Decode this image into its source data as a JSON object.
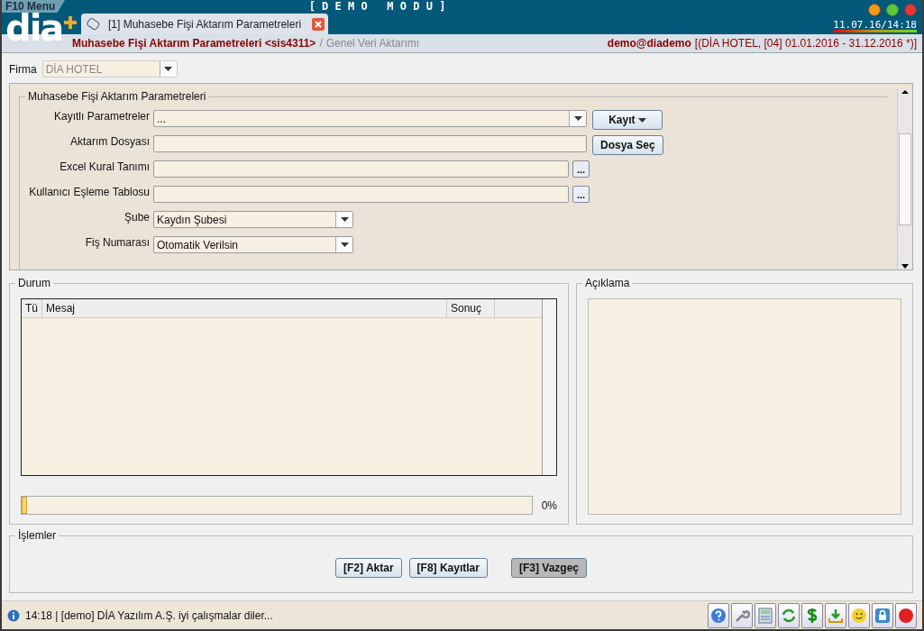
{
  "header": {
    "menu": "F10 Menu",
    "mode": "[ D E M O   M O D U ]",
    "logo": "dia",
    "clock": "11.07.16/14:18"
  },
  "tab": {
    "label": "[1] Muhasebe Fişi Aktarım Parametreleri",
    "selected": true
  },
  "breadcrumb": {
    "title": "Muhasebe Fişi Aktarım Parametreleri <sis4311>",
    "separator": "/",
    "parent": "Genel Veri Aktarımı"
  },
  "user": {
    "name": "demo@diademo",
    "context": "[(DİA HOTEL, [04] 01.01.2016 - 31.12.2016 *)]"
  },
  "firma": {
    "label": "Firma",
    "value": "DİA HOTEL",
    "disabled": true
  },
  "params": {
    "title": "Muhasebe Fişi Aktarım Parametreleri",
    "fields": [
      {
        "kind": "combo",
        "label": "Kayıtlı Parametreler",
        "value": "...",
        "button": "Kayıt"
      },
      {
        "kind": "file",
        "label": "Aktarım Dosyası",
        "button": "Dosya Seç"
      },
      {
        "kind": "lookup",
        "label": "Excel Kural Tanımı",
        "button": "..."
      },
      {
        "kind": "lookup",
        "label": "Kullanıcı Eşleme Tablosu",
        "button": "..."
      },
      {
        "kind": "select",
        "label": "Şube",
        "value": "Kaydın Şubesi"
      },
      {
        "kind": "select",
        "label": "Fiş Numarası",
        "value": "Otomatik Verilsin"
      }
    ]
  },
  "durum": {
    "title": "Durum",
    "columns": [
      "Tü",
      "Mesaj",
      "Sonuç"
    ],
    "progress": {
      "level": 0.01,
      "reading": "0%"
    }
  },
  "aciklama": {
    "title": "Açıklama"
  },
  "islemler": {
    "title": "İşlemler",
    "buttons": [
      {
        "label": "[F2] Aktar",
        "kind": "primary"
      },
      {
        "label": "[F8] Kayıtlar",
        "kind": "primary"
      },
      {
        "label": "[F3] Vazgeç",
        "kind": "secondary"
      }
    ]
  },
  "status": {
    "text": "14:18 | [demo] DİA Yazılım A.Ş. iyi çalışmalar diler..."
  }
}
